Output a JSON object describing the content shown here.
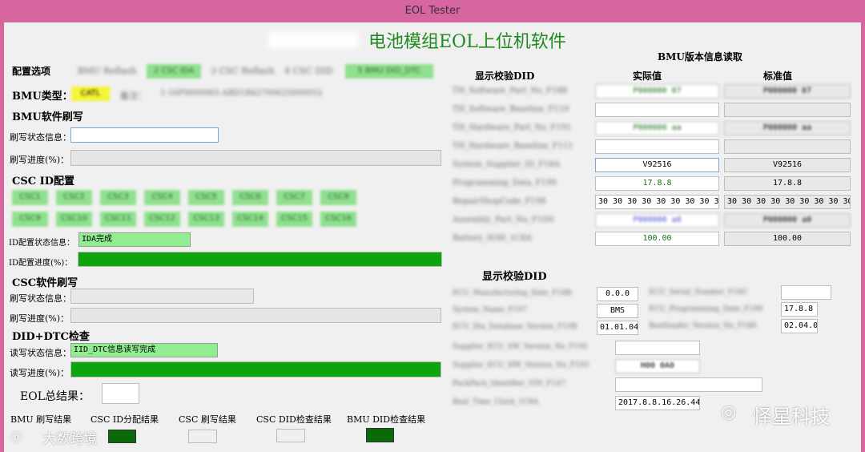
{
  "window": {
    "title": "EOL Tester"
  },
  "main_title": "电池模组EOL上位机软件",
  "config": {
    "label": "配置选项",
    "options": [
      "BMU Reflash",
      "2 CSC IDA",
      "3 CSC Reflash",
      "4 CSC DID",
      "5 BMU DID_DTC"
    ],
    "bmu_type_label": "BMU类型：",
    "bmu_type_value": "CATL",
    "note_label": "备注：",
    "note_value": "1-16P9000065-ABD1B42700625000052"
  },
  "bmu_flash": {
    "title": "BMU软件刷写",
    "status_label": "刷写状态信息：",
    "status_value": "",
    "progress_label": "刷写进度(%)：",
    "progress": 0
  },
  "csc_id": {
    "title": "CSC ID配置",
    "buttons": [
      "CSC1",
      "CSC2",
      "CSC3",
      "CSC4",
      "CSC5",
      "CSC6",
      "CSC7",
      "CSC8",
      "CSC9",
      "CSC10",
      "CSC11",
      "CSC12",
      "CSC13",
      "CSC14",
      "CSC15",
      "CSC16"
    ],
    "status_label": "ID配置状态信息：",
    "status_value": "IDA完成",
    "progress_label": "ID配置进度(%)：",
    "progress": 100
  },
  "csc_flash": {
    "title": "CSC软件刷写",
    "status_label": "刷写状态信息：",
    "status_value": "",
    "progress_label": "刷写进度(%)：",
    "progress": 0
  },
  "did_dtc": {
    "title": "DID+DTC检查",
    "status_label": "读写状态信息：",
    "status_value": "IID_DTC信息读写完成",
    "progress_label": "读写进度(%)：",
    "progress": 100
  },
  "eol_result": {
    "label": "EOL总结果：",
    "value": ""
  },
  "results": [
    {
      "label": "BMU 刷写结果",
      "state": "none"
    },
    {
      "label": "CSC ID分配结果",
      "state": "pass"
    },
    {
      "label": "CSC 刷写结果",
      "state": "idle"
    },
    {
      "label": "CSC DID检查结果",
      "state": "idle"
    },
    {
      "label": "BMU DID检查结果",
      "state": "pass"
    }
  ],
  "bmu_version": {
    "title": "BMU版本信息读取",
    "did_header": "显示校验DID",
    "actual_header": "实际值",
    "standard_header": "标准值",
    "rows": [
      {
        "name": "TH_Software_Part_No_F188",
        "actual": "P000000 07",
        "standard": "P000000 07"
      },
      {
        "name": "TH_Software_Baseline_F110",
        "actual": "",
        "standard": ""
      },
      {
        "name": "TH_Hardware_Part_No_F191",
        "actual": "P000000 aa",
        "standard": "P000000 aa"
      },
      {
        "name": "TH_Hardware_Baseline_F111",
        "actual": "",
        "standard": ""
      },
      {
        "name": "System_Supplier_ID_F18A",
        "actual": "V92516",
        "standard": "V92516"
      },
      {
        "name": "Programming_Data_F199",
        "actual": "17.8.8",
        "standard": "17.8.8"
      },
      {
        "name": "RepairShopCode_F198",
        "actual": "30 30 30 30 30 30 30 30 30",
        "standard": "30 30 30 30 30 30 30 30 30"
      },
      {
        "name": "Assembly_Part_No_F1D0",
        "actual": "P000000 a0",
        "standard": "P000000 a0"
      },
      {
        "name": "Battery_SOH_1C8A",
        "actual": "100.00",
        "standard": "100.00"
      }
    ]
  },
  "ecu_did": {
    "title": "显示校验DID",
    "left": [
      {
        "name": "ECU_Manufacturing_Date_F18B",
        "value": "0.0.0"
      },
      {
        "name": "System_Name_F197",
        "value": "BMS"
      },
      {
        "name": "ECU_Dia_Database_Version_F19B",
        "value": "01.01.04"
      }
    ],
    "right": [
      {
        "name": "ECU_Serial_Number_F18C",
        "value": ""
      },
      {
        "name": "ECU_Programming_Date_F199",
        "value": "17.8.8"
      },
      {
        "name": "Bootloader_Version_No_F180",
        "value": "02.04.06"
      }
    ],
    "wide": [
      {
        "name": "Supplier_ECU_SW_Version_No_F195",
        "value": ""
      },
      {
        "name": "Supplier_ECU_HW_Version_No_F193",
        "value": "H00 0A0"
      },
      {
        "name": "PackPack_Identifier_VIN_F1A7",
        "value": ""
      },
      {
        "name": "Real_Time_Clock_1C8A",
        "value": "2017.8.8.16.26.44"
      }
    ]
  },
  "watermarks": {
    "left": "大数跨境",
    "right": "怿星科技"
  }
}
